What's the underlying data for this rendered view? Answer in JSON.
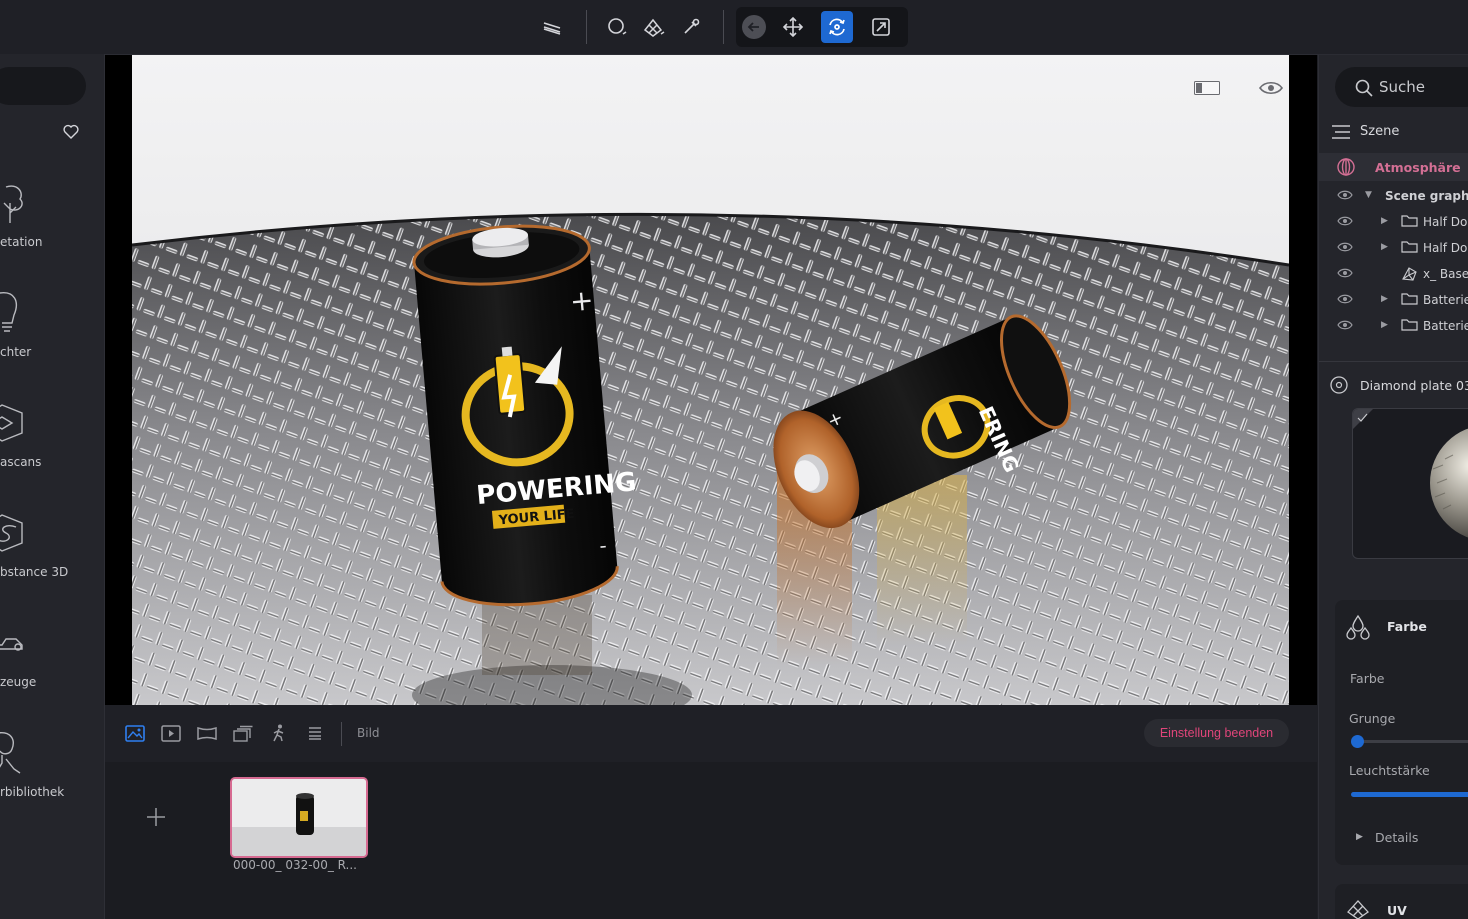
{
  "sidebar": {
    "categories": [
      {
        "label": "etation",
        "icon": "tree-icon"
      },
      {
        "label": "chter",
        "icon": "bulb-icon"
      },
      {
        "label": "ascans",
        "icon": "megascans-icon"
      },
      {
        "label": "bstance 3D",
        "icon": "substance-icon"
      },
      {
        "label": "zeuge",
        "icon": "car-icon"
      },
      {
        "label": "rbibliothek",
        "icon": "person-icon"
      }
    ]
  },
  "bottom": {
    "mode_label": "Bild",
    "end_button": "Einstellung beenden",
    "thumbnail_label": "000-00_ 032-00_ R..."
  },
  "right": {
    "search_placeholder": "Suche",
    "scene_title": "Szene",
    "atmosphere": "Atmosphäre",
    "tree": [
      {
        "label": "Scene graph",
        "type": "root"
      },
      {
        "label": "Half Dor",
        "type": "folder"
      },
      {
        "label": "Half Dor",
        "type": "folder"
      },
      {
        "label": "x_ Base",
        "type": "mesh"
      },
      {
        "label": "Batterie",
        "type": "folder"
      },
      {
        "label": "Batterie",
        "type": "folder"
      }
    ],
    "material_title": "Diamond plate 03",
    "color_section": {
      "title": "Farbe",
      "field_label": "Farbe",
      "grunge_label": "Grunge",
      "grunge_value": 0.02,
      "brightness_label": "Leuchtstärke",
      "brightness_value": 1.0,
      "details_label": "Details"
    },
    "uv_title": "UV"
  },
  "colors": {
    "accent": "#1e69d2",
    "pink": "#e0457a",
    "atmosphere": "#d36f94"
  }
}
